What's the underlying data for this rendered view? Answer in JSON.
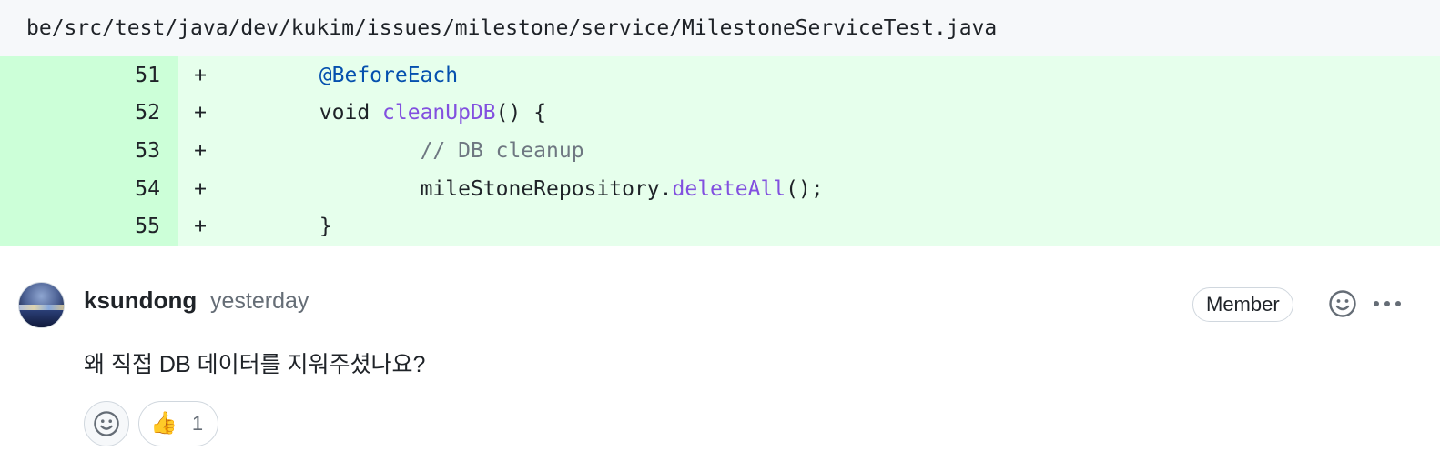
{
  "file": {
    "path": "be/src/test/java/dev/kukim/issues/milestone/service/MilestoneServiceTest.java"
  },
  "diff": {
    "lines": [
      {
        "num": "51",
        "sign": "+",
        "indent": "        ",
        "tokens": [
          {
            "t": "@BeforeEach",
            "c": "ann"
          }
        ]
      },
      {
        "num": "52",
        "sign": "+",
        "indent": "        ",
        "tokens": [
          {
            "t": "void ",
            "c": "tx"
          },
          {
            "t": "cleanUpDB",
            "c": "fn"
          },
          {
            "t": "() {",
            "c": "tx"
          }
        ]
      },
      {
        "num": "53",
        "sign": "+",
        "indent": "                ",
        "tokens": [
          {
            "t": "// DB cleanup",
            "c": "cm"
          }
        ]
      },
      {
        "num": "54",
        "sign": "+",
        "indent": "                ",
        "tokens": [
          {
            "t": "mileStoneRepository.",
            "c": "tx"
          },
          {
            "t": "deleteAll",
            "c": "fn"
          },
          {
            "t": "();",
            "c": "tx"
          }
        ]
      },
      {
        "num": "55",
        "sign": "+",
        "indent": "        ",
        "tokens": [
          {
            "t": "}",
            "c": "tx"
          }
        ]
      }
    ]
  },
  "comment": {
    "author": "ksundong",
    "timestamp": "yesterday",
    "badge": "Member",
    "body": "왜 직접 DB 데이터를 지워주셨나요?",
    "reactions": [
      {
        "emoji": "👍",
        "count": "1"
      }
    ],
    "icons": {
      "add_reaction": "smiley-icon",
      "more": "kebab-horizontal-icon",
      "avatar": "user-avatar"
    }
  },
  "colors": {
    "addition_bg": "#e6ffec",
    "addition_num_bg": "#ccffd8",
    "annotation": "#0550ae",
    "function": "#8250df",
    "comment": "#6e7781"
  }
}
